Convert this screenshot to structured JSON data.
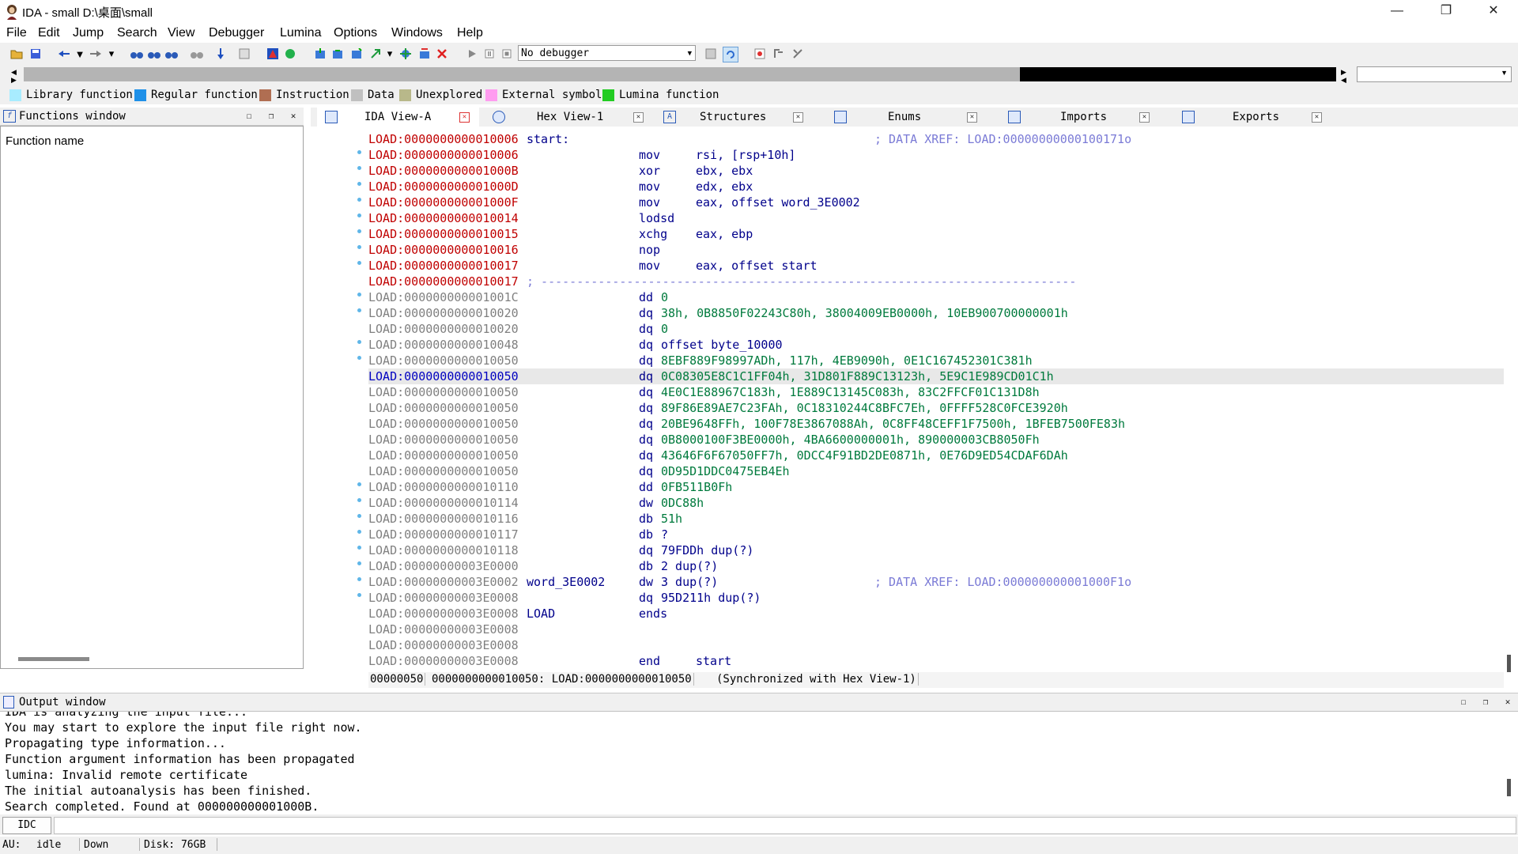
{
  "window": {
    "title": "IDA - small D:\\桌面\\small",
    "minimize": "—",
    "restore": "❐",
    "close": "✕"
  },
  "menu": [
    "File",
    "Edit",
    "Jump",
    "Search",
    "View",
    "Debugger",
    "Lumina",
    "Options",
    "Windows",
    "Help"
  ],
  "toolbar": {
    "debugger": "No debugger"
  },
  "legend": [
    {
      "label": "Library function",
      "color": "#a8ecff"
    },
    {
      "label": "Regular function",
      "color": "#1e90e8"
    },
    {
      "label": "Instruction",
      "color": "#b06e52"
    },
    {
      "label": "Data",
      "color": "#c0c0c0"
    },
    {
      "label": "Unexplored",
      "color": "#b8b88a"
    },
    {
      "label": "External symbol",
      "color": "#ff9cf0"
    },
    {
      "label": "Lumina function",
      "color": "#22cc22"
    }
  ],
  "functions": {
    "title": "Functions window",
    "column": "Function name"
  },
  "tabs": [
    "IDA View-A",
    "Hex View-1",
    "Structures",
    "Enums",
    "Imports",
    "Exports"
  ],
  "code": [
    {
      "addr": "LOAD:0000000000010006",
      "c": "red",
      "label": "start:",
      "mnem": "",
      "ops": "",
      "cmt": "; DATA XREF: LOAD:00000000000100171o",
      "dot": false
    },
    {
      "addr": "LOAD:0000000000010006",
      "c": "red",
      "mnem": "mov",
      "ops": "rsi, [rsp+10h]",
      "dot": true
    },
    {
      "addr": "LOAD:000000000001000B",
      "c": "red",
      "mnem": "xor",
      "ops": "ebx, ebx",
      "dot": true
    },
    {
      "addr": "LOAD:000000000001000D",
      "c": "red",
      "mnem": "mov",
      "ops": "edx, ebx",
      "dot": true
    },
    {
      "addr": "LOAD:000000000001000F",
      "c": "red",
      "mnem": "mov",
      "ops": "eax, offset word_3E0002",
      "dot": true
    },
    {
      "addr": "LOAD:0000000000010014",
      "c": "red",
      "mnem": "lodsd",
      "ops": "",
      "dot": true
    },
    {
      "addr": "LOAD:0000000000010015",
      "c": "red",
      "mnem": "xchg",
      "ops": "eax, ebp",
      "dot": true
    },
    {
      "addr": "LOAD:0000000000010016",
      "c": "red",
      "mnem": "nop",
      "ops": "",
      "dot": true
    },
    {
      "addr": "LOAD:0000000000010017",
      "c": "red",
      "mnem": "mov",
      "ops": "eax, offset start",
      "dot": true
    },
    {
      "addr": "LOAD:0000000000010017",
      "c": "red",
      "sep": "; ---------------------------------------------------------------------------",
      "dot": false
    },
    {
      "addr": "LOAD:000000000001001C",
      "c": "gray",
      "mnem": "dd",
      "ops": "0",
      "green": true,
      "dot": true
    },
    {
      "addr": "LOAD:0000000000010020",
      "c": "gray",
      "mnem": "dq",
      "ops": "38h, 0B8850F02243C80h, 38004009EB0000h, 10EB900700000001h",
      "green": true,
      "dot": true
    },
    {
      "addr": "LOAD:0000000000010020",
      "c": "gray",
      "mnem": "dq",
      "ops": "0",
      "green": true,
      "dot": false
    },
    {
      "addr": "LOAD:0000000000010048",
      "c": "gray",
      "mnem": "dq",
      "ops": "offset byte_10000",
      "dot": true
    },
    {
      "addr": "LOAD:0000000000010050",
      "c": "gray",
      "mnem": "dq",
      "ops": "8EBF889F98997ADh, 117h, 4EB9090h, 0E1C167452301C381h",
      "green": true,
      "dot": true
    },
    {
      "addr": "LOAD:0000000000010050",
      "c": "blue",
      "mnem": "dq",
      "ops": "0C08305E8C1C1FF04h, 31D801F889C13123h, 5E9C1E989CD01C1h",
      "green": true,
      "dot": false,
      "hl": true
    },
    {
      "addr": "LOAD:0000000000010050",
      "c": "gray",
      "mnem": "dq",
      "ops": "4E0C1E88967C183h, 1E889C13145C083h, 83C2FFCF01C131D8h",
      "green": true,
      "dot": false
    },
    {
      "addr": "LOAD:0000000000010050",
      "c": "gray",
      "mnem": "dq",
      "ops": "89F86E89AE7C23FAh, 0C18310244C8BFC7Eh, 0FFFF528C0FCE3920h",
      "green": true,
      "dot": false
    },
    {
      "addr": "LOAD:0000000000010050",
      "c": "gray",
      "mnem": "dq",
      "ops": "20BE9648FFh, 100F78E3867088Ah, 0C8FF48CEFF1F7500h, 1BFEB7500FE83h",
      "green": true,
      "dot": false
    },
    {
      "addr": "LOAD:0000000000010050",
      "c": "gray",
      "mnem": "dq",
      "ops": "0B8000100F3BE0000h, 4BA6600000001h, 890000003CB8050Fh",
      "green": true,
      "dot": false
    },
    {
      "addr": "LOAD:0000000000010050",
      "c": "gray",
      "mnem": "dq",
      "ops": "43646F6F67050FF7h, 0DCC4F91BD2DE0871h, 0E76D9ED54CDAF6DAh",
      "green": true,
      "dot": false
    },
    {
      "addr": "LOAD:0000000000010050",
      "c": "gray",
      "mnem": "dq",
      "ops": "0D95D1DDC0475EB4Eh",
      "green": true,
      "dot": false
    },
    {
      "addr": "LOAD:0000000000010110",
      "c": "gray",
      "mnem": "dd",
      "ops": "0FB511B0Fh",
      "green": true,
      "dot": true
    },
    {
      "addr": "LOAD:0000000000010114",
      "c": "gray",
      "mnem": "dw",
      "ops": "0DC88h",
      "green": true,
      "dot": true
    },
    {
      "addr": "LOAD:0000000000010116",
      "c": "gray",
      "mnem": "db",
      "ops": "51h",
      "green": true,
      "dot": true
    },
    {
      "addr": "LOAD:0000000000010117",
      "c": "gray",
      "mnem": "db",
      "ops": "?",
      "dot": true
    },
    {
      "addr": "LOAD:0000000000010118",
      "c": "gray",
      "mnem": "dq",
      "ops": "79FDDh dup(?)",
      "dot": true
    },
    {
      "addr": "LOAD:00000000003E0000",
      "c": "gray",
      "mnem": "db",
      "ops": "2 dup(?)",
      "dot": true
    },
    {
      "addr": "LOAD:00000000003E0002",
      "c": "gray",
      "label": "word_3E0002",
      "mnem": "dw",
      "ops": "3 dup(?)",
      "cmt": "; DATA XREF: LOAD:000000000001000F1o",
      "dot": true
    },
    {
      "addr": "LOAD:00000000003E0008",
      "c": "gray",
      "mnem": "dq",
      "ops": "95D211h dup(?)",
      "dot": true
    },
    {
      "addr": "LOAD:00000000003E0008",
      "c": "gray",
      "label": "LOAD",
      "mnem": "ends",
      "ops": "",
      "dot": false
    },
    {
      "addr": "LOAD:00000000003E0008",
      "c": "gray",
      "mnem": "",
      "ops": "",
      "dot": false
    },
    {
      "addr": "LOAD:00000000003E0008",
      "c": "gray",
      "mnem": "",
      "ops": "",
      "dot": false
    },
    {
      "addr": "LOAD:00000000003E0008",
      "c": "gray",
      "mnem": "end",
      "ops": "start",
      "dot": false
    }
  ],
  "status_line": {
    "offset": "00000050",
    "location": "0000000000010050: LOAD:0000000000010050",
    "sync": "(Synchronized with Hex View-1)"
  },
  "output": {
    "title": "Output window",
    "lines": [
      "IDA is analyzing the input file...",
      "You may start to explore the input file right now.",
      "Propagating type information...",
      "Function argument information has been propagated",
      "lumina: Invalid remote certificate",
      "The initial autoanalysis has been finished.",
      "Search completed. Found at 000000000001000B."
    ]
  },
  "idc": {
    "button": "IDC"
  },
  "statusbar": {
    "au_label": "AU:",
    "au_value": "idle",
    "direction": "Down",
    "disk": "Disk: 76GB"
  }
}
